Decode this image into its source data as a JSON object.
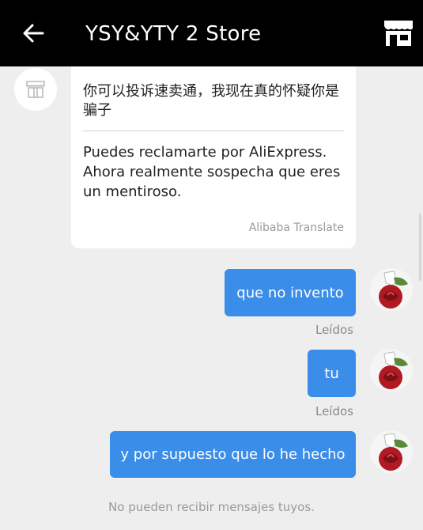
{
  "header": {
    "title": "YSY&YTY 2 Store",
    "back_icon": "arrow-left-icon",
    "store_icon": "storefront-icon"
  },
  "incoming": {
    "avatar_icon": "store-icon",
    "original_text": "你可以投诉速卖通，我现在真的怀疑你是骗子",
    "translated_text": "Puedes reclamarte por AliExpress. Ahora realmente sospecha que eres un mentiroso.",
    "translation_credit": "Alibaba Translate"
  },
  "outgoing": [
    {
      "text": "que no invento",
      "status": "Leídos"
    },
    {
      "text": "tu",
      "status": "Leídos"
    },
    {
      "text": "y por supuesto que lo he hecho"
    }
  ],
  "footer": {
    "note": "No pueden recibir mensajes tuyos."
  },
  "colors": {
    "header_bg": "#000000",
    "bubble_out": "#3a8de8",
    "background": "#eeeeee"
  }
}
